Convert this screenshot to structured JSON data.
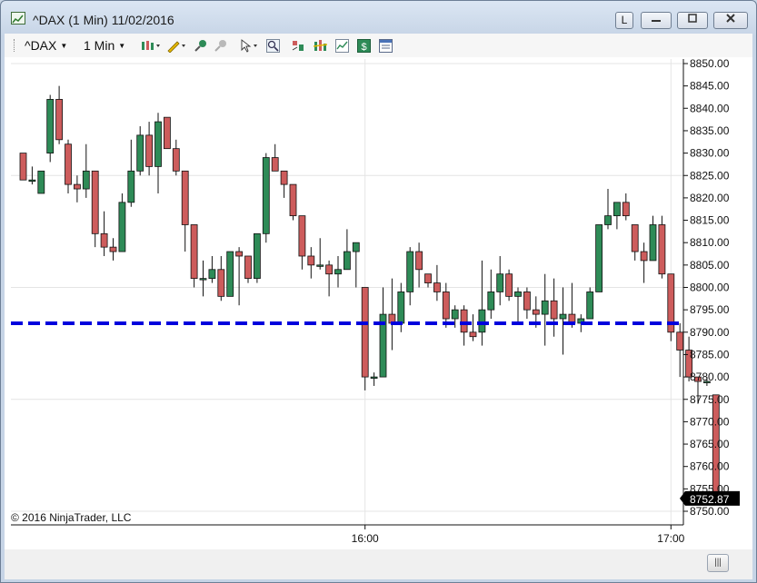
{
  "window": {
    "title": "^DAX (1 Min)  11/02/2016",
    "buttons": {
      "link_label": "L"
    }
  },
  "toolbar": {
    "instrument": "^DAX",
    "interval": "1 Min",
    "icons": [
      "bar-type-icon",
      "drawing-pencil-icon",
      "zoom-in-icon",
      "zoom-out-icon",
      "pointer-icon",
      "magnifier-icon",
      "strategies-icon",
      "indicators-icon",
      "chart-style-icon",
      "dollar-icon",
      "properties-icon"
    ]
  },
  "copyright": "© 2016 NinjaTrader, LLC",
  "colors": {
    "up": "#2e8b57",
    "down": "#cd5c5c",
    "level_line": "#0000dd",
    "price_tag_bg": "#000000"
  },
  "chart_data": {
    "type": "candlestick",
    "ylim": [
      8750,
      8850
    ],
    "y_ticks": [
      "8850.00",
      "8845.00",
      "8840.00",
      "8835.00",
      "8830.00",
      "8825.00",
      "8820.00",
      "8815.00",
      "8810.00",
      "8805.00",
      "8800.00",
      "8795.00",
      "8790.00",
      "8785.00",
      "8780.00",
      "8775.00",
      "8770.00",
      "8765.00",
      "8760.00",
      "8755.00",
      "8750.00"
    ],
    "x_ticks": [
      {
        "label": "16:00",
        "index": 38
      },
      {
        "label": "17:00",
        "index": 72
      }
    ],
    "horizontal_line": 8792,
    "last_price": {
      "value": 8752.87,
      "label": "8752.87"
    },
    "candles": [
      [
        8830,
        8830,
        8824,
        8824
      ],
      [
        8824,
        8827,
        8823,
        8824
      ],
      [
        8821,
        8826,
        8821,
        8826
      ],
      [
        8830,
        8843,
        8828,
        8842
      ],
      [
        8842,
        8845,
        8832,
        8833
      ],
      [
        8832,
        8833,
        8821,
        8823
      ],
      [
        8823,
        8825,
        8819,
        8822
      ],
      [
        8822,
        8832,
        8820,
        8826
      ],
      [
        8826,
        8826,
        8809,
        8812
      ],
      [
        8812,
        8817,
        8807,
        8809
      ],
      [
        8809,
        8811,
        8806,
        8808
      ],
      [
        8808,
        8821,
        8808,
        8819
      ],
      [
        8819,
        8833,
        8818,
        8826
      ],
      [
        8826,
        8836,
        8825,
        8834
      ],
      [
        8834,
        8837,
        8825,
        8827
      ],
      [
        8827,
        8839,
        8821,
        8837
      ],
      [
        8838,
        8838,
        8831,
        8831
      ],
      [
        8831,
        8833,
        8825,
        8826
      ],
      [
        8826,
        8826,
        8808,
        8814
      ],
      [
        8814,
        8814,
        8800,
        8802
      ],
      [
        8802,
        8806,
        8798,
        8802
      ],
      [
        8802,
        8807,
        8801,
        8804
      ],
      [
        8804,
        8807,
        8797,
        8798
      ],
      [
        8798,
        8808,
        8798,
        8808
      ],
      [
        8808,
        8809,
        8796,
        8807
      ],
      [
        8807,
        8807,
        8801,
        8802
      ],
      [
        8802,
        8812,
        8801,
        8812
      ],
      [
        8812,
        8830,
        8810,
        8829
      ],
      [
        8829,
        8832,
        8826,
        8826
      ],
      [
        8826,
        8826,
        8820,
        8823
      ],
      [
        8823,
        8823,
        8815,
        8816
      ],
      [
        8816,
        8816,
        8804,
        8807
      ],
      [
        8807,
        8809,
        8802,
        8805
      ],
      [
        8805,
        8811,
        8804,
        8805
      ],
      [
        8805,
        8806,
        8798,
        8803
      ],
      [
        8803,
        8807,
        8800,
        8804
      ],
      [
        8804,
        8813,
        8804,
        8808
      ],
      [
        8808,
        8810,
        8800,
        8810
      ],
      [
        8800,
        8800,
        8777,
        8780
      ],
      [
        8780,
        8781,
        8778,
        8780
      ],
      [
        8780,
        8800,
        8780,
        8794
      ],
      [
        8794,
        8802,
        8786,
        8792
      ],
      [
        8792,
        8801,
        8790,
        8799
      ],
      [
        8799,
        8809,
        8796,
        8808
      ],
      [
        8808,
        8810,
        8800,
        8804
      ],
      [
        8803,
        8803,
        8800,
        8801
      ],
      [
        8801,
        8805,
        8797,
        8799
      ],
      [
        8799,
        8801,
        8791,
        8793
      ],
      [
        8793,
        8796,
        8791,
        8795
      ],
      [
        8795,
        8796,
        8787,
        8790
      ],
      [
        8790,
        8794,
        8788,
        8789
      ],
      [
        8790,
        8806,
        8787,
        8795
      ],
      [
        8795,
        8804,
        8793,
        8799
      ],
      [
        8799,
        8807,
        8796,
        8803
      ],
      [
        8803,
        8804,
        8797,
        8798
      ],
      [
        8798,
        8800,
        8792,
        8799
      ],
      [
        8799,
        8800,
        8793,
        8795
      ],
      [
        8795,
        8798,
        8791,
        8794
      ],
      [
        8794,
        8803,
        8787,
        8797
      ],
      [
        8797,
        8802,
        8789,
        8793
      ],
      [
        8793,
        8800,
        8785,
        8794
      ],
      [
        8794,
        8801,
        8791,
        8792
      ],
      [
        8792,
        8794,
        8790,
        8793
      ],
      [
        8793,
        8800,
        8793,
        8799
      ],
      [
        8799,
        8814,
        8799,
        8814
      ],
      [
        8814,
        8822,
        8813,
        8816
      ],
      [
        8816,
        8818,
        8813,
        8819
      ],
      [
        8819,
        8821,
        8815,
        8816
      ],
      [
        8814,
        8814,
        8806,
        8808
      ],
      [
        8808,
        8810,
        8801,
        8806
      ],
      [
        8806,
        8816,
        8806,
        8814
      ],
      [
        8814,
        8816,
        8802,
        8803
      ],
      [
        8803,
        8803,
        8788,
        8790
      ],
      [
        8790,
        8792,
        8780,
        8786
      ],
      [
        8786,
        8789,
        8779,
        8780
      ],
      [
        8780,
        8780,
        8774,
        8779
      ],
      [
        8779,
        8780,
        8778,
        8779
      ],
      [
        8776,
        8776,
        8753,
        8753
      ]
    ]
  }
}
